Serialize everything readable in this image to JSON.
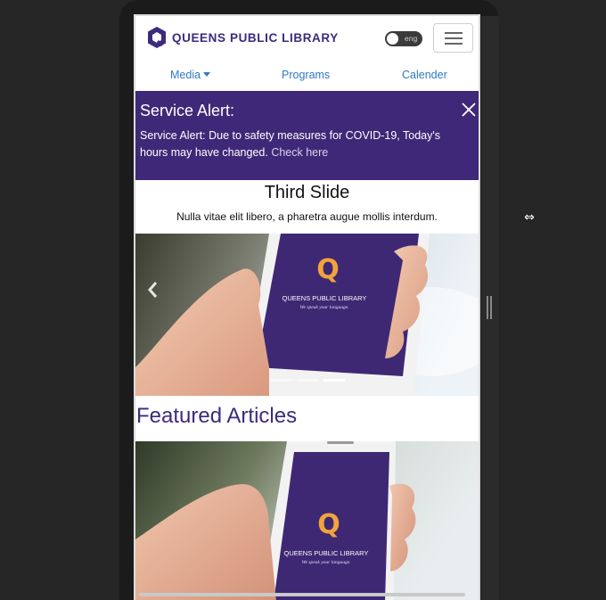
{
  "header": {
    "logo_text": "QUEENS PUBLIC LIBRARY",
    "lang_label": "eng",
    "brand_color": "#3d2a7d"
  },
  "nav": {
    "media": "Media",
    "programs": "Programs",
    "calender": "Calender",
    "link_color": "#2f79c5"
  },
  "alert": {
    "title": "Service Alert:",
    "body": "Service Alert: Due to safety measures for COVID-19, Today's hours may have changed.",
    "link_text": "Check here",
    "background": "#402878"
  },
  "carousel": {
    "title": "Third Slide",
    "caption": "Nulla vitae elit libero, a pharetra augue mollis interdum.",
    "phone_logo_text": "QUEENS PUBLIC LIBRARY",
    "phone_tagline": "We speak your language."
  },
  "featured": {
    "title": "Featured Articles",
    "phone_logo_text": "QUEENS PUBLIC LIBRARY",
    "phone_tagline": "We speak your language."
  },
  "icons": {
    "close": "close-icon",
    "menu": "hamburger-menu-icon",
    "prev": "chevron-left-icon",
    "cursor": "horizontal-resize-cursor-icon"
  }
}
